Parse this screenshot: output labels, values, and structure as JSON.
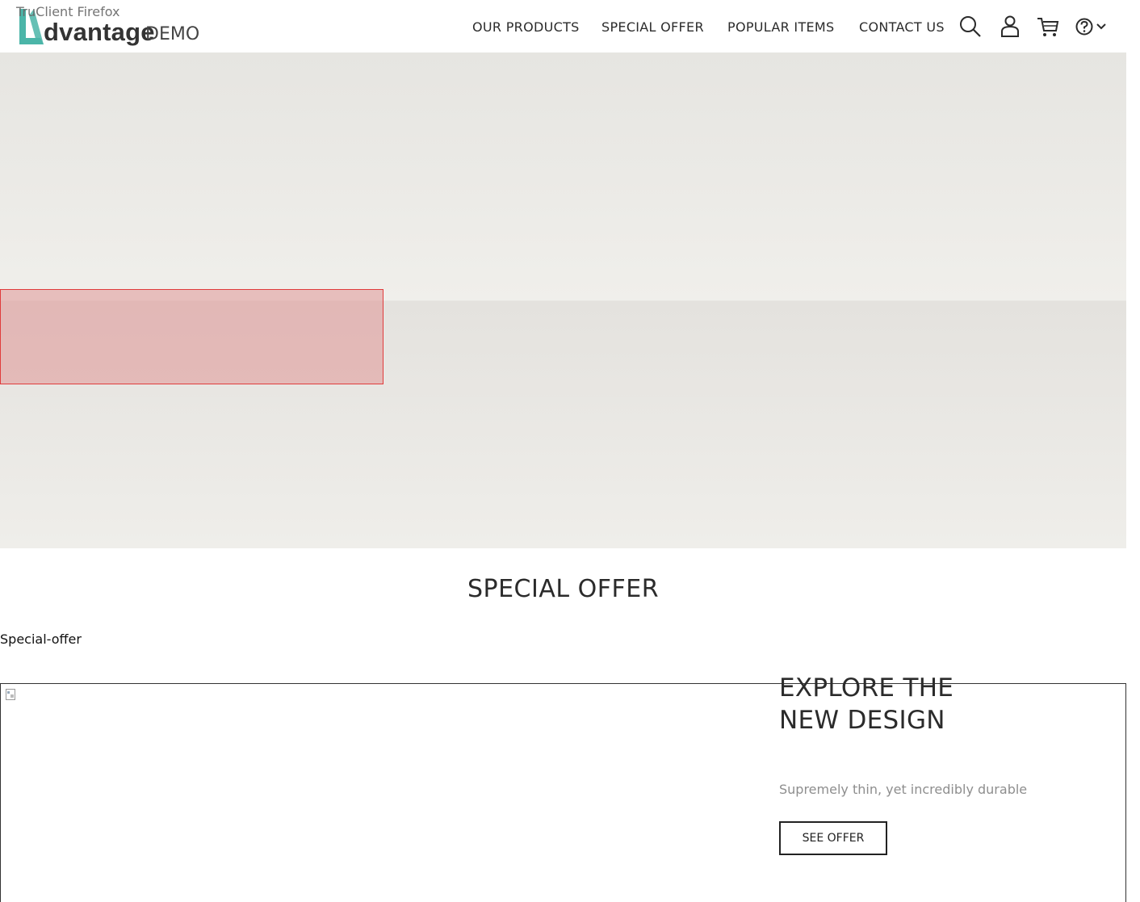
{
  "browser": {
    "label": "TruClient Firefox"
  },
  "logo": {
    "word": "dvantage",
    "suffix": "DEMO",
    "mark_color": "#4bb5a8"
  },
  "nav": {
    "items": [
      {
        "label": "OUR PRODUCTS"
      },
      {
        "label": "SPECIAL OFFER"
      },
      {
        "label": "POPULAR ITEMS"
      },
      {
        "label": "CONTACT US"
      }
    ],
    "icons": [
      "search-icon",
      "user-icon",
      "cart-icon",
      "help-icon",
      "chevron-down-icon"
    ]
  },
  "special_offer": {
    "title": "SPECIAL OFFER",
    "caption": "Special-offer",
    "heading": "EXPLORE THE NEW DESIGN",
    "subtitle": "Supremely thin, yet incredibly durable",
    "button": "SEE OFFER"
  }
}
